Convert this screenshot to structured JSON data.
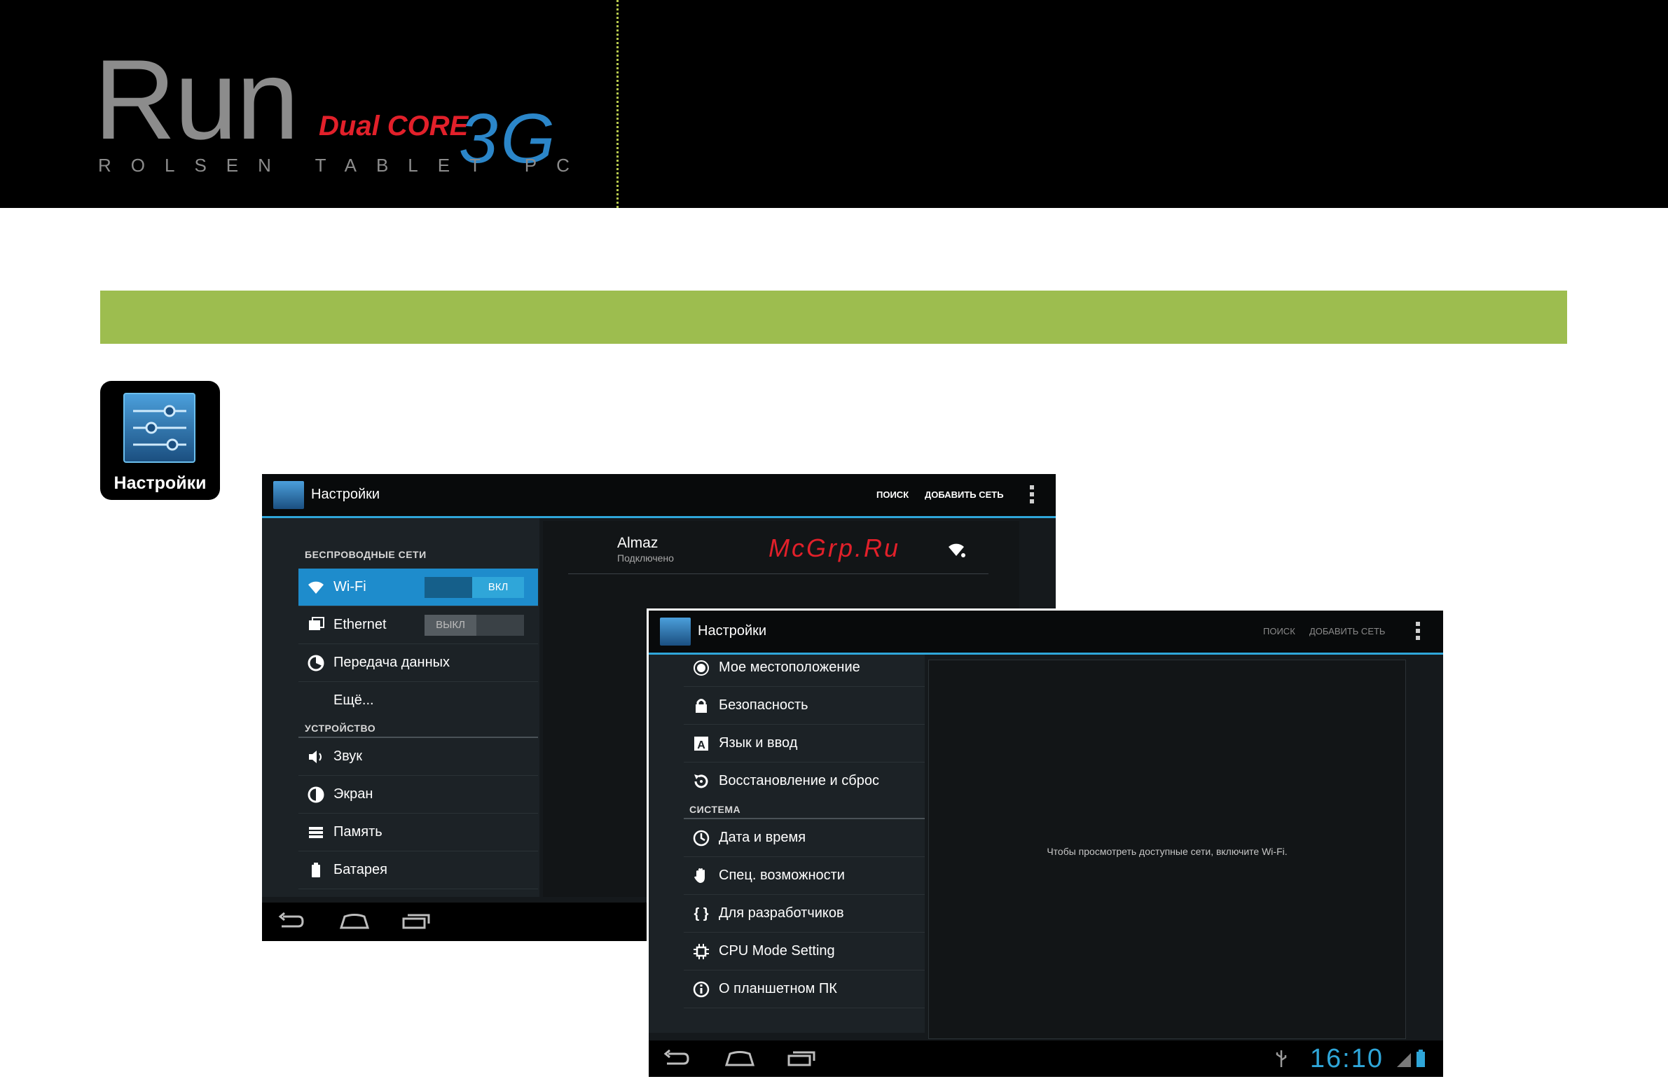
{
  "header": {
    "logo_run": "Run",
    "logo_dual": "Dual CORE",
    "logo_3g": "3G",
    "logo_sub": "ROLSEN TABLET PC"
  },
  "app_icon": {
    "label": "Настройки",
    "icon": "settings-sliders-icon"
  },
  "screen1": {
    "title": "Настройки",
    "actions": {
      "search": "ПОИСК",
      "add_network": "ДОБАВИТЬ СЕТЬ"
    },
    "sections": {
      "wireless": "БЕСПРОВОДНЫЕ СЕТИ",
      "device": "УСТРОЙСТВО"
    },
    "items": [
      {
        "label": "Wi-Fi",
        "icon": "wifi-icon",
        "toggle": "ВКЛ"
      },
      {
        "label": "Ethernet",
        "icon": "ethernet-icon",
        "toggle": "ВЫКЛ"
      },
      {
        "label": "Передача данных",
        "icon": "data-usage-icon"
      },
      {
        "label": "Ещё..."
      },
      {
        "label": "Звук",
        "icon": "sound-icon"
      },
      {
        "label": "Экран",
        "icon": "display-icon"
      },
      {
        "label": "Память",
        "icon": "storage-icon"
      },
      {
        "label": "Батарея",
        "icon": "battery-icon"
      }
    ],
    "network": {
      "name": "Almaz",
      "status": "Подключено"
    },
    "watermark": "McGrp.Ru"
  },
  "screen2": {
    "title": "Настройки",
    "actions": {
      "search": "ПОИСК",
      "add_network": "ДОБАВИТЬ СЕТЬ"
    },
    "section_system": "СИСТЕМА",
    "items": [
      {
        "label": "Мое местоположение",
        "icon": "location-icon"
      },
      {
        "label": "Безопасность",
        "icon": "lock-icon"
      },
      {
        "label": "Язык и ввод",
        "icon": "language-icon"
      },
      {
        "label": "Восстановление и сброс",
        "icon": "restore-icon"
      },
      {
        "label": "Дата и время",
        "icon": "clock-icon"
      },
      {
        "label": "Спец. возможности",
        "icon": "accessibility-icon"
      },
      {
        "label": "Для разработчиков",
        "icon": "braces-icon"
      },
      {
        "label": "CPU Mode Setting",
        "icon": "cpu-icon"
      },
      {
        "label": "О планшетном ПК",
        "icon": "info-icon"
      }
    ],
    "message": "Чтобы просмотреть доступные сети, включите Wi-Fi.",
    "clock": "16:10"
  }
}
